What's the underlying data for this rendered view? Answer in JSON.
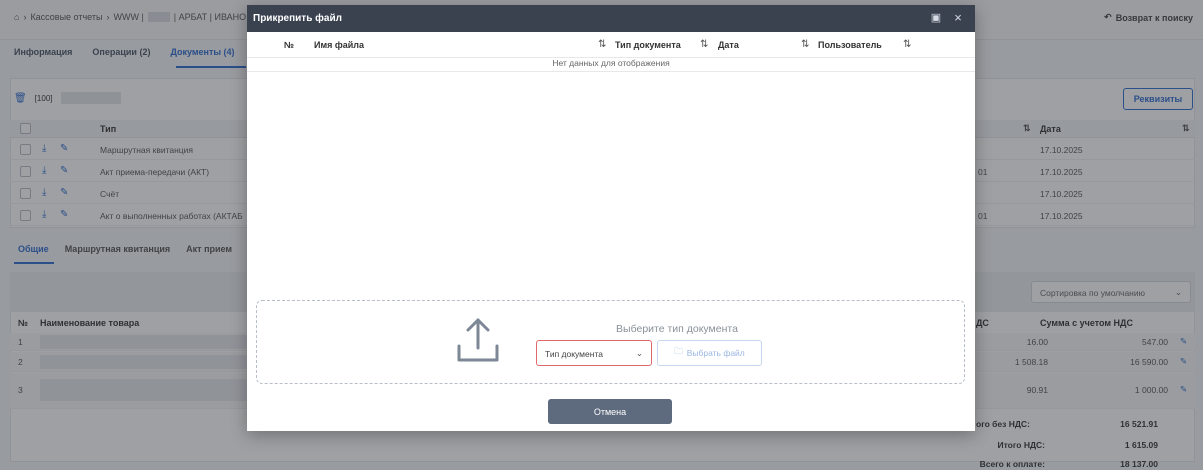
{
  "background": {
    "breadcrumb": [
      "Кассовые отчеты",
      "WWW |",
      "| АРБАТ | ИВАНО"
    ],
    "back_label": "Возврат к поиску",
    "tabs": [
      "Информация",
      "Операции (2)",
      "Документы (4)"
    ],
    "filter_label": "[100]",
    "rekvizity_label": "Реквизиты",
    "docs_header": {
      "type": "Тип",
      "date": "Дата"
    },
    "docs": [
      {
        "name": "Маршрутная квитанция",
        "code": "",
        "date": "17.10.2025"
      },
      {
        "name": "Акт приема-передачи (АКТ)",
        "code": "01",
        "date": "17.10.2025"
      },
      {
        "name": "Счёт",
        "code": "",
        "date": "17.10.2025"
      },
      {
        "name": "Акт о выполненных работах (АКТАБ",
        "code": "01",
        "date": "17.10.2025"
      }
    ],
    "subtabs": [
      "Общие",
      "Маршрутная квитанция",
      "Акт прием"
    ],
    "sort_label": "Сортировка по умолчанию",
    "goods_header": {
      "num": "№",
      "name": "Наименование товара",
      "nds": "ДС",
      "sum": "Сумма с учетом НДС"
    },
    "goods": [
      {
        "num": "1",
        "nds": "16.00",
        "sum": "547.00"
      },
      {
        "num": "2",
        "nds": "1 508.18",
        "sum": "16 590.00"
      },
      {
        "num": "3",
        "nds": "90.91",
        "sum": "1 000.00"
      }
    ],
    "totals": [
      {
        "label": "ого без НДС:",
        "value": "16 521.91"
      },
      {
        "label": "Итого НДС:",
        "value": "1 615.09"
      },
      {
        "label": "Всего к оплате:",
        "value": "18 137.00"
      }
    ]
  },
  "modal": {
    "title": "Прикрепить файл",
    "columns": [
      "№",
      "Имя файла",
      "Тип документа",
      "Дата",
      "Пользователь"
    ],
    "empty_text": "Нет данных для отображения",
    "upload_hint": "Выберите тип документа",
    "doc_type_placeholder": "Тип документа",
    "choose_file_label": "Выбрать файл",
    "cancel_label": "Отмена"
  },
  "colors": {
    "accent": "#2f6ccf",
    "modal_header": "#3a4250",
    "cancel_button": "#5e6b7e",
    "error_border": "#e0696c"
  }
}
